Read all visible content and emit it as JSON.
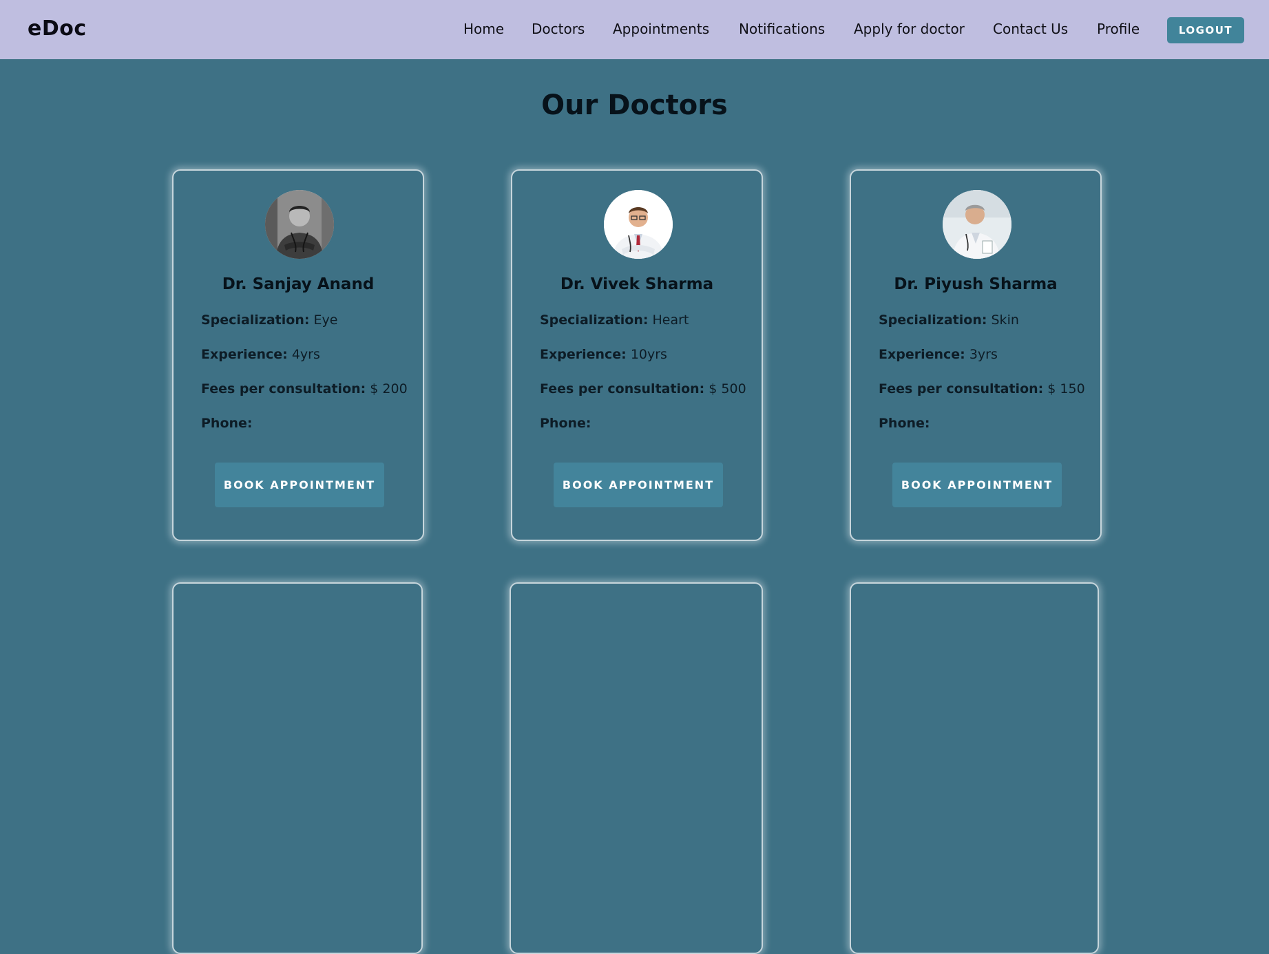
{
  "app": {
    "brand": "eDoc"
  },
  "nav": {
    "items": [
      {
        "label": "Home"
      },
      {
        "label": "Doctors"
      },
      {
        "label": "Appointments"
      },
      {
        "label": "Notifications"
      },
      {
        "label": "Apply for doctor"
      },
      {
        "label": "Contact Us"
      },
      {
        "label": "Profile"
      }
    ],
    "logout_label": "LOGOUT"
  },
  "page": {
    "title": "Our Doctors"
  },
  "labels": {
    "specialization": "Specialization:",
    "experience": "Experience:",
    "fees": "Fees per consultation:",
    "phone": "Phone:",
    "book": "BOOK APPOINTMENT"
  },
  "doctors": [
    {
      "name": "Dr. Sanjay Anand",
      "specialization": "Eye",
      "experience": "4yrs",
      "fees": "$ 200",
      "phone": ""
    },
    {
      "name": "Dr. Vivek Sharma",
      "specialization": "Heart",
      "experience": "10yrs",
      "fees": "$ 500",
      "phone": ""
    },
    {
      "name": "Dr. Piyush Sharma",
      "specialization": "Skin",
      "experience": "3yrs",
      "fees": "$ 150",
      "phone": ""
    }
  ],
  "colors": {
    "navbar": "#bfbee0",
    "background": "#3e7185",
    "button": "#43849b",
    "text": "#07121a"
  }
}
